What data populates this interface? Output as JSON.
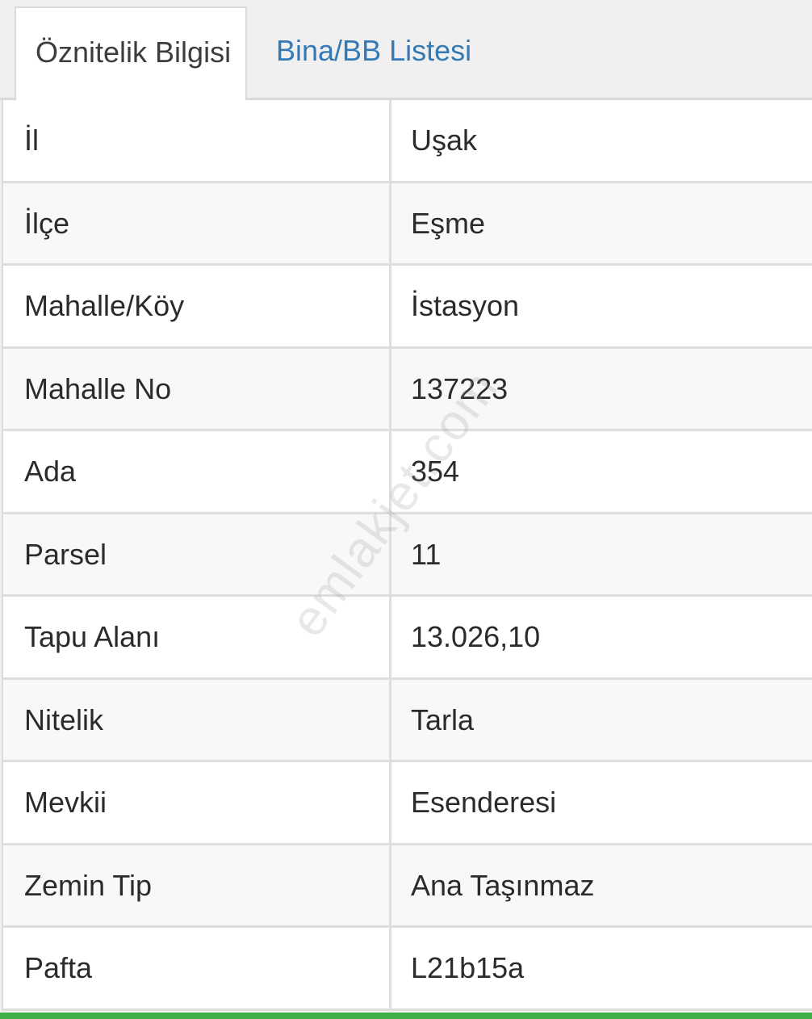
{
  "tabs": [
    {
      "label": "Öznitelik Bilgisi",
      "active": true
    },
    {
      "label": "Bina/BB Listesi",
      "active": false
    }
  ],
  "rows": [
    {
      "key": "İl",
      "value": "Uşak"
    },
    {
      "key": "İlçe",
      "value": "Eşme"
    },
    {
      "key": "Mahalle/Köy",
      "value": "İstasyon"
    },
    {
      "key": "Mahalle No",
      "value": "137223"
    },
    {
      "key": "Ada",
      "value": "354"
    },
    {
      "key": "Parsel",
      "value": "11"
    },
    {
      "key": "Tapu Alanı",
      "value": "13.026,10"
    },
    {
      "key": "Nitelik",
      "value": "Tarla"
    },
    {
      "key": "Mevkii",
      "value": "Esenderesi"
    },
    {
      "key": "Zemin Tip",
      "value": "Ana Taşınmaz"
    },
    {
      "key": "Pafta",
      "value": "L21b15a"
    }
  ],
  "watermark": "emlakjet.com",
  "colors": {
    "link": "#337ab7",
    "accent_bar": "#3fae49"
  }
}
